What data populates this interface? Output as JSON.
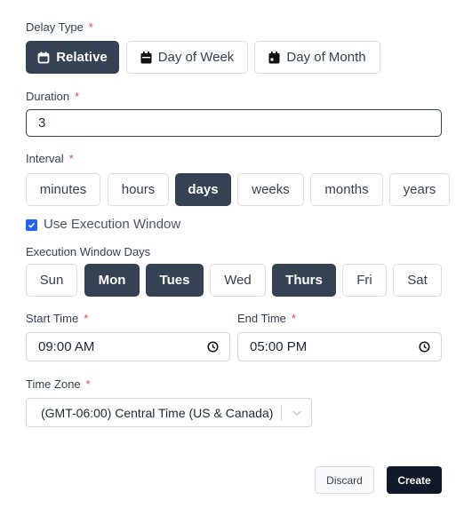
{
  "delay_type": {
    "label": "Delay Type",
    "required": "*",
    "options": [
      {
        "label": "Relative",
        "icon": "calendar-outline-icon",
        "selected": true
      },
      {
        "label": "Day of Week",
        "icon": "calendar-icon",
        "selected": false
      },
      {
        "label": "Day of Month",
        "icon": "calendar-day-icon",
        "selected": false
      }
    ]
  },
  "duration": {
    "label": "Duration",
    "required": "*",
    "value": "3"
  },
  "interval": {
    "label": "Interval",
    "required": "*",
    "options": [
      {
        "label": "minutes",
        "selected": false
      },
      {
        "label": "hours",
        "selected": false
      },
      {
        "label": "days",
        "selected": true
      },
      {
        "label": "weeks",
        "selected": false
      },
      {
        "label": "months",
        "selected": false
      },
      {
        "label": "years",
        "selected": false
      }
    ]
  },
  "execution_window": {
    "checkbox_label": "Use Execution Window",
    "checked": true
  },
  "execution_window_days": {
    "label": "Execution Window Days",
    "options": [
      {
        "label": "Sun",
        "selected": false
      },
      {
        "label": "Mon",
        "selected": true
      },
      {
        "label": "Tues",
        "selected": true
      },
      {
        "label": "Wed",
        "selected": false
      },
      {
        "label": "Thurs",
        "selected": true
      },
      {
        "label": "Fri",
        "selected": false
      },
      {
        "label": "Sat",
        "selected": false
      }
    ]
  },
  "start_time": {
    "label": "Start Time",
    "required": "*",
    "value": "09:00 AM"
  },
  "end_time": {
    "label": "End Time",
    "required": "*",
    "value": "05:00 PM"
  },
  "time_zone": {
    "label": "Time Zone",
    "required": "*",
    "value": "(GMT-06:00) Central Time (US & Canada)"
  },
  "footer": {
    "discard_label": "Discard",
    "create_label": "Create"
  },
  "colors": {
    "selected_bg": "#344254",
    "create_bg": "#111827",
    "checkbox": "#2563eb",
    "required": "#ef4444"
  }
}
